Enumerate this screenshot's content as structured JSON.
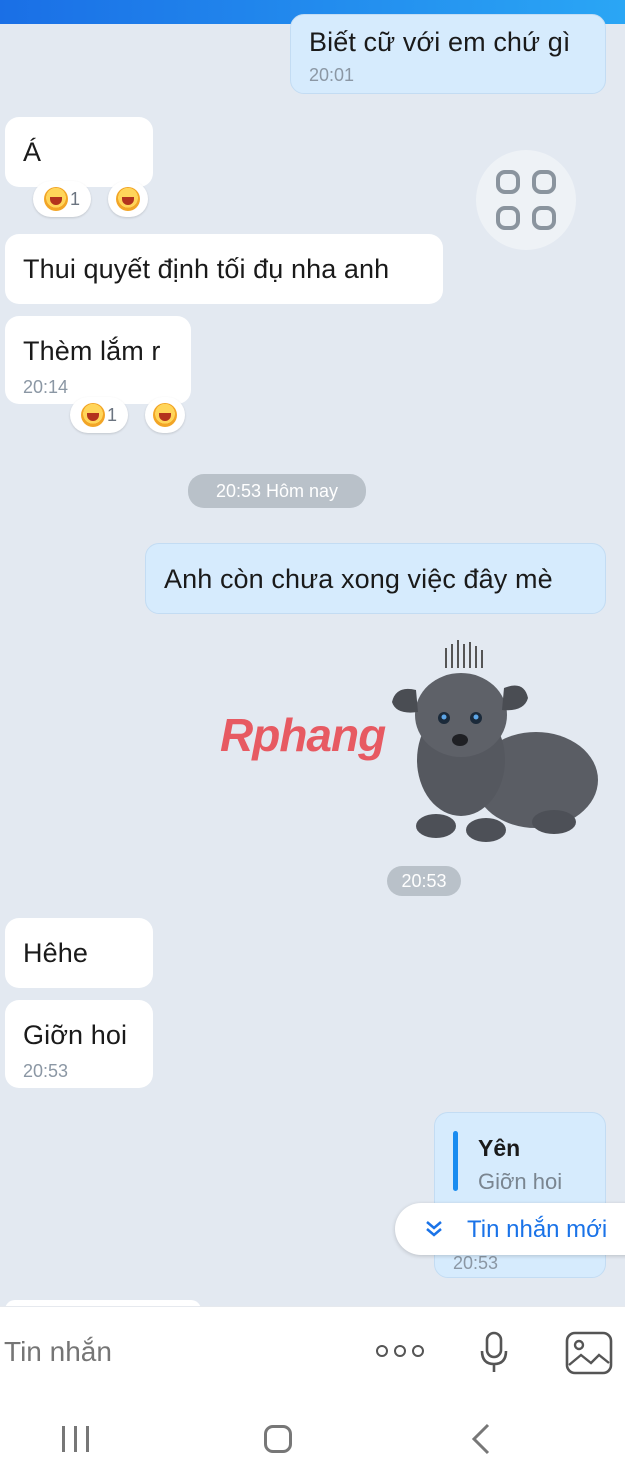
{
  "messages": {
    "m1": {
      "text": "Biết cữ với em chứ gì",
      "time": "20:01"
    },
    "m2": {
      "text": "Á",
      "reactions": [
        {
          "count": "1"
        },
        {
          "count": ""
        }
      ]
    },
    "m3": {
      "text": "Thui quyết định tối đụ nha anh"
    },
    "m4": {
      "text": "Thèm lắm r",
      "time": "20:14",
      "reactions": [
        {
          "count": "1"
        },
        {
          "count": ""
        }
      ]
    },
    "day_separator": "20:53 Hôm nay",
    "m5": {
      "text": "Anh còn chưa xong việc đây mè"
    },
    "sticker": {
      "time": "20:53",
      "watermark": "Rphang"
    },
    "m6": {
      "text": "Hêhe"
    },
    "m7": {
      "text": "Giỡn hoi",
      "time": "20:53"
    },
    "m8": {
      "quote_author": "Yên",
      "quote_text": "Giỡn hoi",
      "time": "20:53"
    }
  },
  "new_messages_label": "Tin nhắn mới",
  "composer": {
    "placeholder": "Tin nhắn"
  },
  "colors": {
    "accent": "#1a6fe6",
    "outgoing_bubble": "#d6ebfd",
    "incoming_bubble": "#ffffff",
    "background": "#e3e9f1"
  }
}
